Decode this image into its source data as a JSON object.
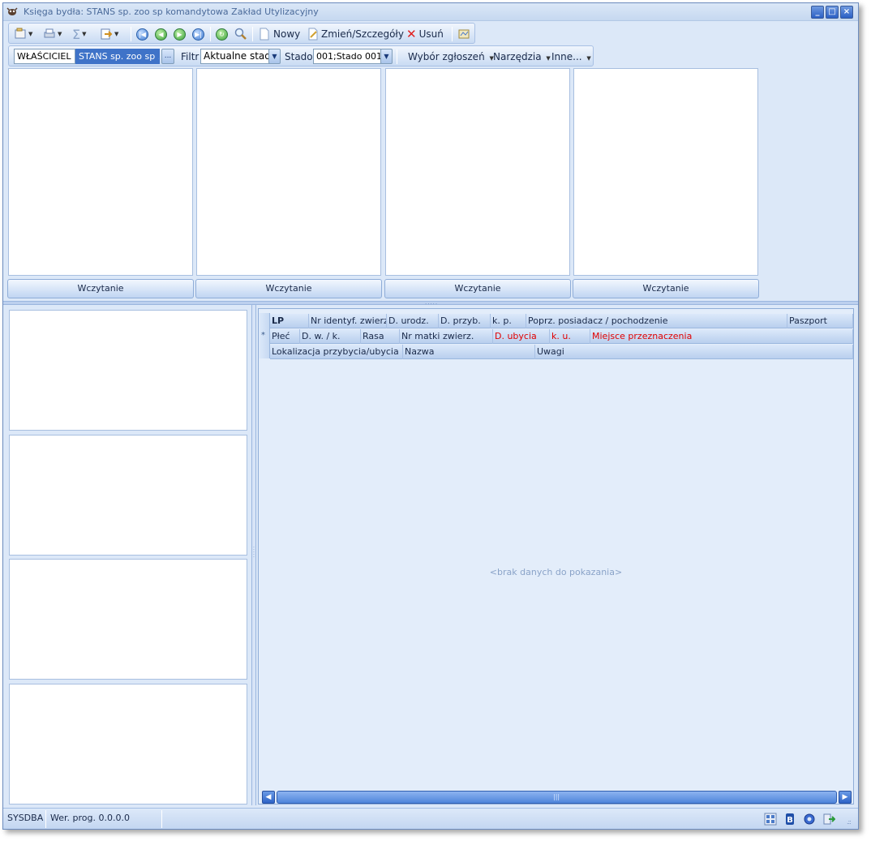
{
  "window": {
    "title": "Księga bydła: STANS sp. zoo sp komandytowa Zakład Utylizacyjny",
    "minimize_glyph": "_",
    "maximize_glyph": "□",
    "close_glyph": "×"
  },
  "toolbar1": {
    "new_label": "Nowy",
    "edit_label": "Zmień/Szczegóły",
    "delete_label": "Usuń",
    "icons": [
      "properties-icon",
      "print-icon",
      "sum-icon",
      "export-icon",
      "first-record-icon",
      "prev-record-icon",
      "next-record-icon",
      "last-record-icon",
      "refresh-icon",
      "search-icon",
      "new-document-icon",
      "edit-icon",
      "delete-icon",
      "report-icon"
    ]
  },
  "toolbar2": {
    "owner_label": "WŁAŚCICIEL",
    "owner_value": "STANS sp. zoo sp ...",
    "owner_button": "...",
    "filter_label": "Filtr",
    "filter_value": "Aktualne stado",
    "herd_label": "Stado",
    "herd_value": "001;Stado 001",
    "menu_requests": "Wybór zgłoszeń",
    "menu_tools": "Narzędzia",
    "menu_other": "Inne..."
  },
  "top_panels": {
    "load_buttons": [
      "Wczytanie",
      "Wczytanie",
      "Wczytanie",
      "Wczytanie"
    ]
  },
  "grid": {
    "row1": [
      "LP",
      "Nr identyf. zwierz.",
      "D. urodz.",
      "D. przyb.",
      "k. p.",
      "Poprz. posiadacz / pochodzenie",
      "Paszport"
    ],
    "row2": [
      "Płeć",
      "D. w. / k.",
      "Rasa",
      "Nr matki zwierz.",
      "D. ubycia",
      "k. u.",
      "Miejsce przeznaczenia"
    ],
    "row3": [
      "Lokalizacja przybycia/ubycia",
      "Nazwa",
      "Uwagi"
    ],
    "new_row_marker": "*",
    "empty_message": "<brak danych do pokazania>"
  },
  "statusbar": {
    "user": "SYSDBA",
    "version": "Wer. prog. 0.0.0.0"
  },
  "colors": {
    "window_bg": "#dce8f8",
    "accent_blue": "#2d63c7",
    "red_header": "#e00000",
    "empty_text": "#8aa3c8"
  }
}
